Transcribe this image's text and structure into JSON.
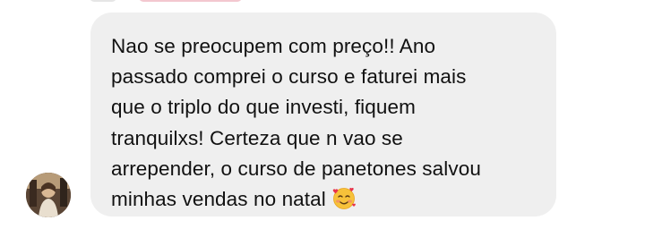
{
  "message": {
    "lines": [
      "Nao se preocupem com preço!! Ano",
      "passado comprei o curso e faturei mais",
      "que o triplo do que investi, fiquem",
      "tranquilxs! Certeza que n vao se",
      "arrepender, o curso de panetones salvou",
      "minhas vendas no natal"
    ],
    "emoji": "🥰"
  },
  "icons": {
    "avatar": "profile-photo",
    "emoji": "smiling-face-with-hearts"
  },
  "colors": {
    "bubble": "#efefef",
    "text": "#111111"
  }
}
